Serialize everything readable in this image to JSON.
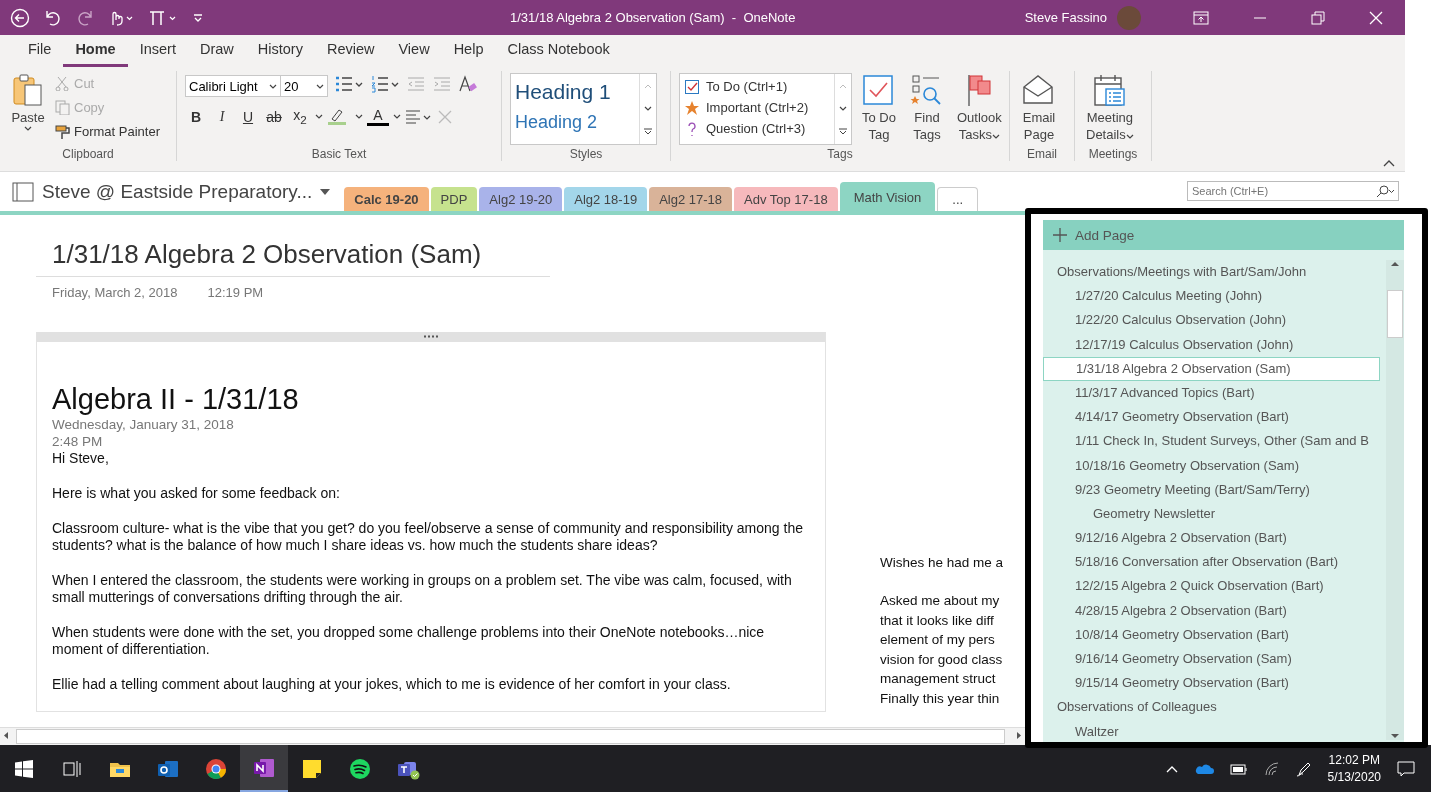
{
  "title_bar": {
    "title": "1/31/18 Algebra 2 Observation (Sam)  -  OneNote",
    "user": "Steve Fassino"
  },
  "ribbon_tabs": [
    {
      "label": "File",
      "selected": false
    },
    {
      "label": "Home",
      "selected": true
    },
    {
      "label": "Insert",
      "selected": false
    },
    {
      "label": "Draw",
      "selected": false
    },
    {
      "label": "History",
      "selected": false
    },
    {
      "label": "Review",
      "selected": false
    },
    {
      "label": "View",
      "selected": false
    },
    {
      "label": "Help",
      "selected": false
    },
    {
      "label": "Class Notebook",
      "selected": false
    }
  ],
  "ribbon": {
    "clipboard": {
      "label": "Clipboard",
      "paste": "Paste",
      "items": [
        {
          "kind": "cut",
          "label": "Cut",
          "disabled": true
        },
        {
          "kind": "copy",
          "label": "Copy",
          "disabled": true
        },
        {
          "kind": "painter",
          "label": "Format Painter",
          "disabled": false
        }
      ]
    },
    "basic_text": {
      "label": "Basic Text",
      "font": "Calibri Light",
      "size": "20",
      "format_buttons": [
        {
          "kind": "bold",
          "label": "B"
        },
        {
          "kind": "italic",
          "label": "I"
        },
        {
          "kind": "underline",
          "label": "U"
        },
        {
          "kind": "strike",
          "label": "ab"
        },
        {
          "kind": "subscript",
          "label": "x$_{2}$"
        }
      ],
      "font_color_label": "A"
    },
    "styles": {
      "label": "Styles",
      "items": [
        "Heading 1",
        "Heading 2"
      ]
    },
    "tags": {
      "label": "Tags",
      "items": [
        {
          "kind": "todo",
          "label": "To Do (Ctrl+1)"
        },
        {
          "kind": "important",
          "label": "Important (Ctrl+2)"
        },
        {
          "kind": "question",
          "label": "Question (Ctrl+3)"
        }
      ],
      "buttons": [
        {
          "kind": "todo-tag",
          "label": "To Do\nTag",
          "menu": false
        },
        {
          "kind": "find-tags",
          "label": "Find\nTags",
          "menu": false
        },
        {
          "kind": "outlook-tasks",
          "label": "Outlook\nTasks",
          "menu": true
        }
      ]
    },
    "email": {
      "label": "Email",
      "button": "Email\nPage"
    },
    "meetings": {
      "label": "Meetings",
      "button": "Meeting\nDetails"
    }
  },
  "notebook": {
    "name": "Steve @ Eastside Preparatory...",
    "sections": [
      {
        "label": "Calc 19-20",
        "color": "#f5b27c",
        "selected": false,
        "unread": true
      },
      {
        "label": "PDP",
        "color": "#c6e28e",
        "selected": false,
        "unread": false
      },
      {
        "label": "Alg2 19-20",
        "color": "#a9b3ea",
        "selected": false,
        "unread": false
      },
      {
        "label": "Alg2 18-19",
        "color": "#a3d6ea",
        "selected": false,
        "unread": false
      },
      {
        "label": "Alg2 17-18",
        "color": "#d9b399",
        "selected": false,
        "unread": false
      },
      {
        "label": "Adv Top 17-18",
        "color": "#f6b9bc",
        "selected": false,
        "unread": false
      },
      {
        "label": "Math Vision",
        "color": "#8dd5c3",
        "selected": true,
        "unread": false
      }
    ],
    "more": "...",
    "search_placeholder": "Search (Ctrl+E)"
  },
  "page": {
    "title": "1/31/18 Algebra 2 Observation (Sam)",
    "date": "Friday, March 2, 2018",
    "time": "12:19 PM",
    "note": {
      "heading": "Algebra II - 1/31/18",
      "date": "Wednesday, January 31, 2018",
      "time": "2:48 PM",
      "paragraphs": [
        "Hi Steve,",
        "Here is what you asked for some feedback on:",
        "Classroom culture- what is the vibe that you get? do you feel/observe a sense of community and responsibility among the students? what is the balance of how much I share ideas vs. how much the students share ideas?",
        "When I entered the classroom, the students were working in groups on a problem set. The vibe was calm, focused, with small mutterings of conversations drifting through the air.",
        "When students were done with the set, you dropped some challenge problems into their OneNote notebooks…nice moment of differentiation.",
        "Ellie had a telling comment about laughing at your jokes, which to me is evidence of her comfort in your class."
      ]
    },
    "side_note": [
      [
        "Wishes he had me a"
      ],
      [
        "Asked me about my",
        "that it looks like diff",
        "element of my pers",
        "vision for good class",
        "management struct",
        "Finally this year thin"
      ]
    ]
  },
  "pages_panel": {
    "add_page": "Add Page",
    "pages": [
      {
        "title": "Observations/Meetings with Bart/Sam/John",
        "selected": false,
        "children": [
          {
            "title": "1/27/20 Calculus Meeting (John)",
            "selected": false
          },
          {
            "title": "1/22/20 Calculus Observation (John)",
            "selected": false
          },
          {
            "title": "12/17/19 Calculus Observation (John)",
            "selected": false
          },
          {
            "title": "1/31/18 Algebra 2 Observation (Sam)",
            "selected": true
          },
          {
            "title": "11/3/17 Advanced Topics (Bart)",
            "selected": false
          },
          {
            "title": "4/14/17 Geometry Observation (Bart)",
            "selected": false
          },
          {
            "title": "1/11 Check In, Student Surveys, Other (Sam and B",
            "selected": false
          },
          {
            "title": "10/18/16 Geometry Observation (Sam)",
            "selected": false
          },
          {
            "title": "9/23 Geometry Meeting (Bart/Sam/Terry)",
            "selected": false,
            "children": [
              {
                "title": "Geometry Newsletter",
                "selected": false
              }
            ]
          },
          {
            "title": "9/12/16 Algebra 2 Observation (Bart)",
            "selected": false
          },
          {
            "title": "5/18/16 Conversation after Observation (Bart)",
            "selected": false
          },
          {
            "title": "12/2/15 Algebra 2 Quick Observation (Bart)",
            "selected": false
          },
          {
            "title": "4/28/15 Algebra 2 Observation (Bart)",
            "selected": false
          },
          {
            "title": "10/8/14 Geometry Observation (Bart)",
            "selected": false
          },
          {
            "title": "9/16/14 Geometry Observation (Sam)",
            "selected": false
          },
          {
            "title": "9/15/14 Geometry Observation (Bart)",
            "selected": false
          }
        ]
      },
      {
        "title": "Observations of Colleagues",
        "selected": false,
        "children": [
          {
            "title": "Waltzer",
            "selected": false
          }
        ]
      }
    ]
  },
  "taskbar": {
    "apps": [
      {
        "kind": "explorer",
        "active": false
      },
      {
        "kind": "outlook",
        "active": false
      },
      {
        "kind": "chrome",
        "active": false
      },
      {
        "kind": "onenote",
        "active": true
      },
      {
        "kind": "sticky",
        "active": false
      },
      {
        "kind": "spotify",
        "active": false
      },
      {
        "kind": "teams",
        "active": false
      }
    ],
    "time": "12:02 PM",
    "date": "5/13/2020"
  }
}
